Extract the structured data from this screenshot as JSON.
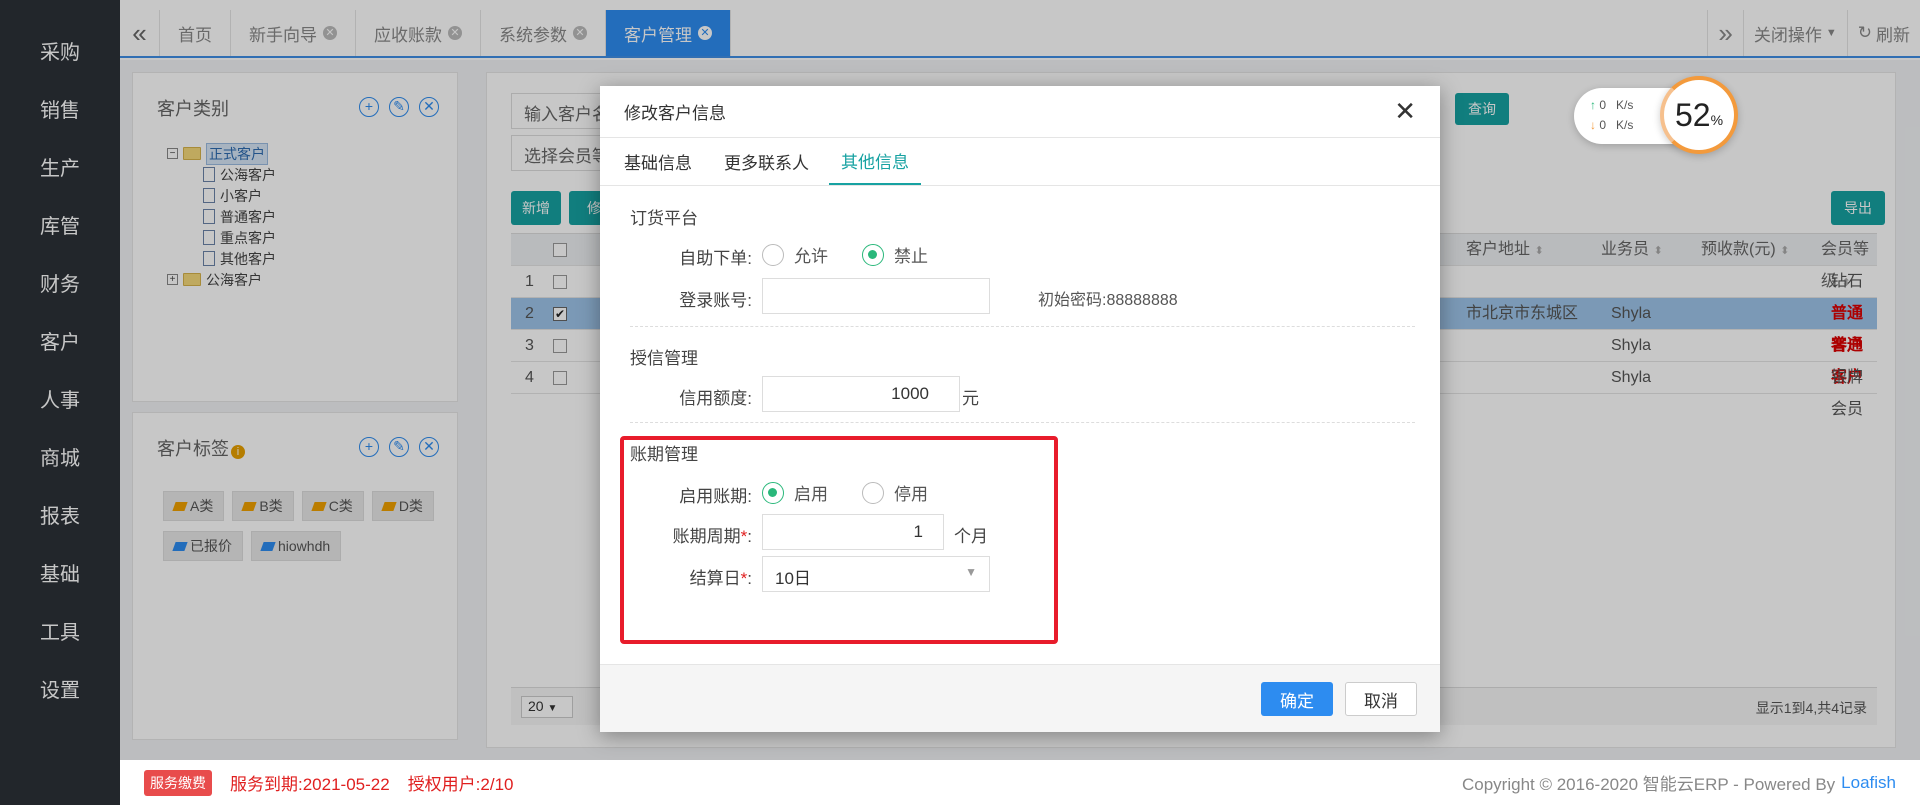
{
  "sidebar": {
    "items": [
      "采购",
      "销售",
      "生产",
      "库管",
      "财务",
      "客户",
      "人事",
      "商城",
      "报表",
      "基础",
      "工具",
      "设置"
    ]
  },
  "topbar": {
    "tabs": [
      {
        "label": "首页",
        "closable": false
      },
      {
        "label": "新手向导",
        "closable": true
      },
      {
        "label": "应收账款",
        "closable": true
      },
      {
        "label": "系统参数",
        "closable": true
      },
      {
        "label": "客户管理",
        "closable": true,
        "active": true
      }
    ],
    "close_ops": "关闭操作",
    "refresh": "刷新"
  },
  "category_panel": {
    "title": "客户类别",
    "tree": {
      "root1": "正式客户",
      "children": [
        "公海客户",
        "小客户",
        "普通客户",
        "重点客户",
        "其他客户"
      ],
      "root2": "公海客户"
    }
  },
  "tag_panel": {
    "title": "客户标签",
    "tags": [
      {
        "label": "A类",
        "color": "#f0a000"
      },
      {
        "label": "B类",
        "color": "#f0a000"
      },
      {
        "label": "C类",
        "color": "#f0a000"
      },
      {
        "label": "D类",
        "color": "#f0a000"
      },
      {
        "label": "已报价",
        "color": "#2d8cf0"
      },
      {
        "label": "hiowhdh",
        "color": "#2d8cf0"
      }
    ]
  },
  "main": {
    "search_placeholder": "输入客户名",
    "member_placeholder": "选择会员等",
    "query_btn": "查询",
    "add_btn": "新增",
    "edit_btn": "修",
    "export_btn": "导出",
    "columns": {
      "addr": "客户地址",
      "sales": "业务员",
      "prepay": "预收款(元)",
      "level": "会员等级"
    },
    "rows": [
      {
        "idx": "1",
        "addr": "",
        "sales": "",
        "level": "钻石会员",
        "checked": false
      },
      {
        "idx": "2",
        "addr": "市北京市东城区",
        "sales": "Shyla",
        "level": "普通客户",
        "checked": true
      },
      {
        "idx": "3",
        "addr": "",
        "sales": "Shyla",
        "level": "普通客户",
        "checked": false
      },
      {
        "idx": "4",
        "addr": "",
        "sales": "Shyla",
        "level": "银牌会员",
        "checked": false
      }
    ],
    "page_size": "20",
    "pager_info": "显示1到4,共4记录"
  },
  "modal": {
    "title": "修改客户信息",
    "tabs": [
      "基础信息",
      "更多联系人",
      "其他信息"
    ],
    "order_platform": {
      "title": "订货平台",
      "self_order_label": "自助下单:",
      "opt_allow": "允许",
      "opt_forbid": "禁止",
      "login_label": "登录账号:",
      "login_value": "",
      "init_pwd": "初始密码:88888888"
    },
    "credit": {
      "title": "授信管理",
      "limit_label": "信用额度:",
      "limit_value": "1000",
      "unit": "元"
    },
    "period": {
      "title": "账期管理",
      "enable_label": "启用账期:",
      "opt_on": "启用",
      "opt_off": "停用",
      "cycle_label": "账期周期",
      "cycle_value": "1",
      "cycle_unit": "个月",
      "settle_label": "结算日",
      "settle_value": "10日"
    },
    "confirm": "确定",
    "cancel": "取消"
  },
  "speed": {
    "up": "0",
    "down": "0",
    "unit": "K/s",
    "percent": "52",
    "pct_sign": "%"
  },
  "footer": {
    "badge": "服务缴费",
    "expire": "服务到期:2021-05-22",
    "users": "授权用户:2/10",
    "copyright": "Copyright © 2016-2020 智能云ERP - Powered By",
    "brand": "Loafish"
  }
}
